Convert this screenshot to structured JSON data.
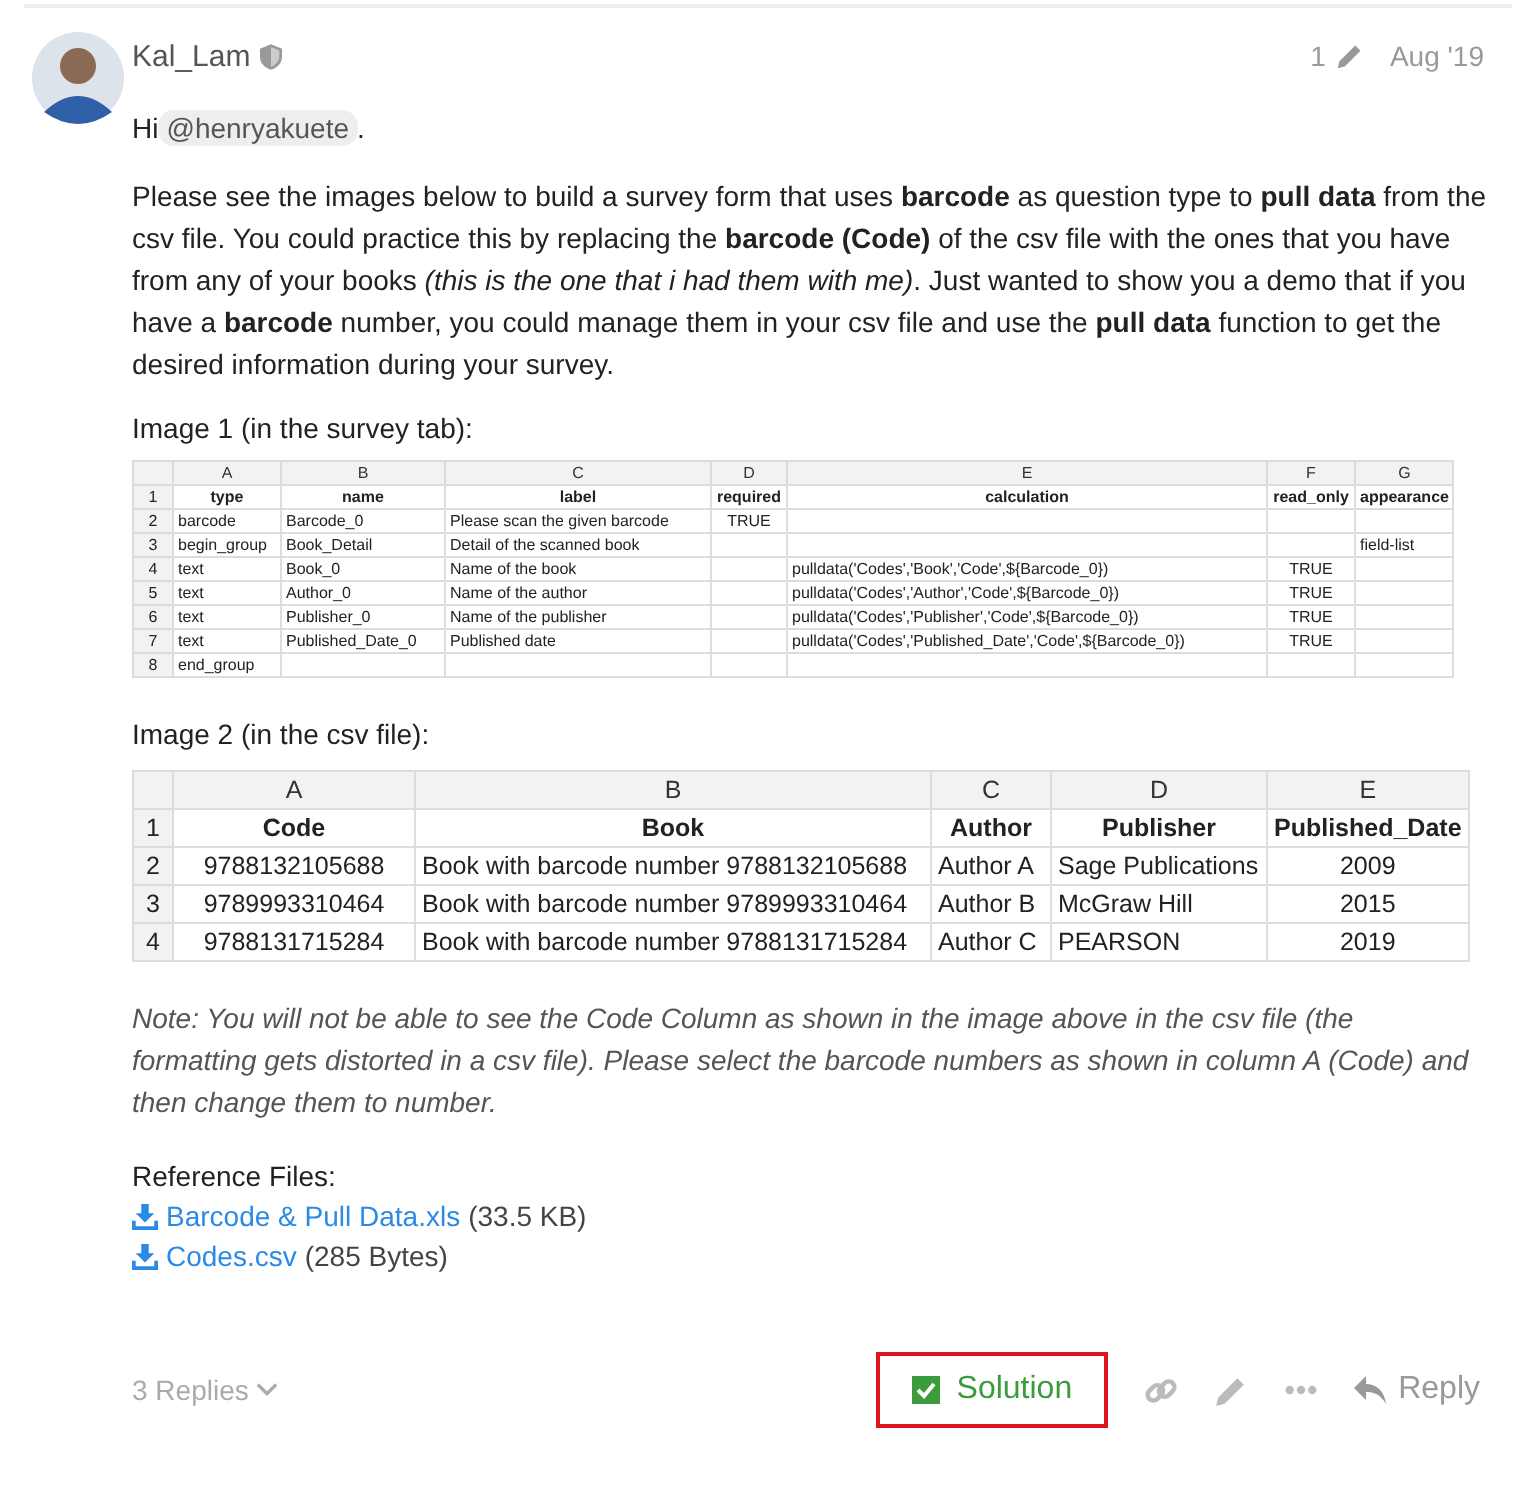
{
  "post": {
    "author": "Kal_Lam",
    "edit_count": "1",
    "date": "Aug '19"
  },
  "greeting": {
    "text": "Hi",
    "mention": "@henryakuete",
    "end": "."
  },
  "paragraph": "Please see the images below to build a survey form that uses **barcode** as question type to **pull data** from the csv file. You could practice this by replacing the **barcode (Code)** of the csv file with the ones that you have from any of your books *(this is the one that i had them with me)*. Just wanted to show you a demo that if you have a **barcode** number, you could manage them in your csv file and use the **pull data** function to get the desired information during your survey.",
  "image1_caption": "Image 1 (in the survey tab):",
  "sheet1": {
    "columns": [
      "A",
      "B",
      "C",
      "D",
      "E",
      "F",
      "G"
    ],
    "rows": [
      {
        "number": "1",
        "cells": [
          "type",
          "name",
          "label",
          "required",
          "calculation",
          "read_only",
          "appearance"
        ]
      },
      {
        "number": "2",
        "cells": [
          "barcode",
          "Barcode_0",
          "Please scan the given barcode",
          "TRUE",
          "",
          "",
          ""
        ]
      },
      {
        "number": "3",
        "cells": [
          "begin_group",
          "Book_Detail",
          "Detail of the scanned book",
          "",
          "",
          "",
          "field-list"
        ]
      },
      {
        "number": "4",
        "cells": [
          "text",
          "Book_0",
          "Name of the book",
          "",
          "pulldata('Codes','Book','Code',${Barcode_0})",
          "TRUE",
          ""
        ]
      },
      {
        "number": "5",
        "cells": [
          "text",
          "Author_0",
          "Name of the author",
          "",
          "pulldata('Codes','Author','Code',${Barcode_0})",
          "TRUE",
          ""
        ]
      },
      {
        "number": "6",
        "cells": [
          "text",
          "Publisher_0",
          "Name of the publisher",
          "",
          "pulldata('Codes','Publisher','Code',${Barcode_0})",
          "TRUE",
          ""
        ]
      },
      {
        "number": "7",
        "cells": [
          "text",
          "Published_Date_0",
          "Published date",
          "",
          "pulldata('Codes','Published_Date','Code',${Barcode_0})",
          "TRUE",
          ""
        ]
      },
      {
        "number": "8",
        "cells": [
          "end_group",
          "",
          "",
          "",
          "",
          "",
          ""
        ]
      }
    ]
  },
  "image2_caption": "Image 2 (in the csv file):",
  "sheet2": {
    "columns": [
      "A",
      "B",
      "C",
      "D",
      "E"
    ],
    "rows": [
      {
        "number": "1",
        "cells": [
          "Code",
          "Book",
          "Author",
          "Publisher",
          "Published_Date"
        ]
      },
      {
        "number": "2",
        "cells": [
          "9788132105688",
          "Book with barcode number 9788132105688",
          "Author A",
          "Sage Publications",
          "2009"
        ]
      },
      {
        "number": "3",
        "cells": [
          "9789993310464",
          "Book with barcode number 9789993310464",
          "Author B",
          "McGraw Hill",
          "2015"
        ]
      },
      {
        "number": "4",
        "cells": [
          "9788131715284",
          "Book with barcode number 9788131715284",
          "Author C",
          "PEARSON",
          "2019"
        ]
      }
    ]
  },
  "note": "Note: You will not be able to see the Code Column as shown in the image above in the csv file (the formatting gets distorted in a csv file). Please select the barcode numbers as shown in column A (Code) and then change them to number.",
  "reference_title": "Reference Files:",
  "attachments": [
    {
      "name": "Barcode & Pull Data.xls",
      "size": "(33.5 KB)"
    },
    {
      "name": "Codes.csv",
      "size": "(285 Bytes)"
    }
  ],
  "footer": {
    "replies": "3 Replies",
    "solution": {
      "label": "Solution",
      "checked": true,
      "highlighted": true
    },
    "reply": "Reply"
  }
}
